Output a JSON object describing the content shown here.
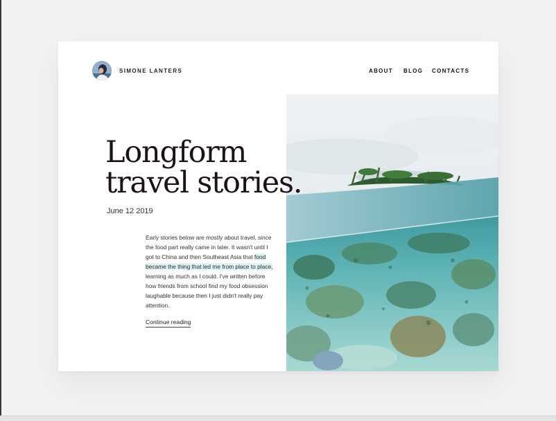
{
  "header": {
    "brand_name": "SIMONE LANTERS",
    "nav": {
      "about": "ABOUT",
      "blog": "BLOG",
      "contacts": "CONTACTS"
    }
  },
  "hero": {
    "title_line1": "Longform",
    "title_line2": "travel stories.",
    "date": "June 12 2019",
    "excerpt_before": "Early stories below are mostly about travel, since the food part really came in later. It wasn't until I got to China and then Southeast Asia that ",
    "excerpt_highlight": "food became the thing that led me from place to place,",
    "excerpt_after": " learning as much as I could. I've written before how friends from school find my food obsession laughable because then I just didn't really pay attention.",
    "cta_label": "Continue reading"
  },
  "colors": {
    "page_background": "#f2f2f3",
    "card_background": "#ffffff",
    "title_color": "#1e1314",
    "highlight": "#ddf3f3",
    "water": "#5fb5b5"
  },
  "icons": {
    "avatar": "profile-photo"
  }
}
